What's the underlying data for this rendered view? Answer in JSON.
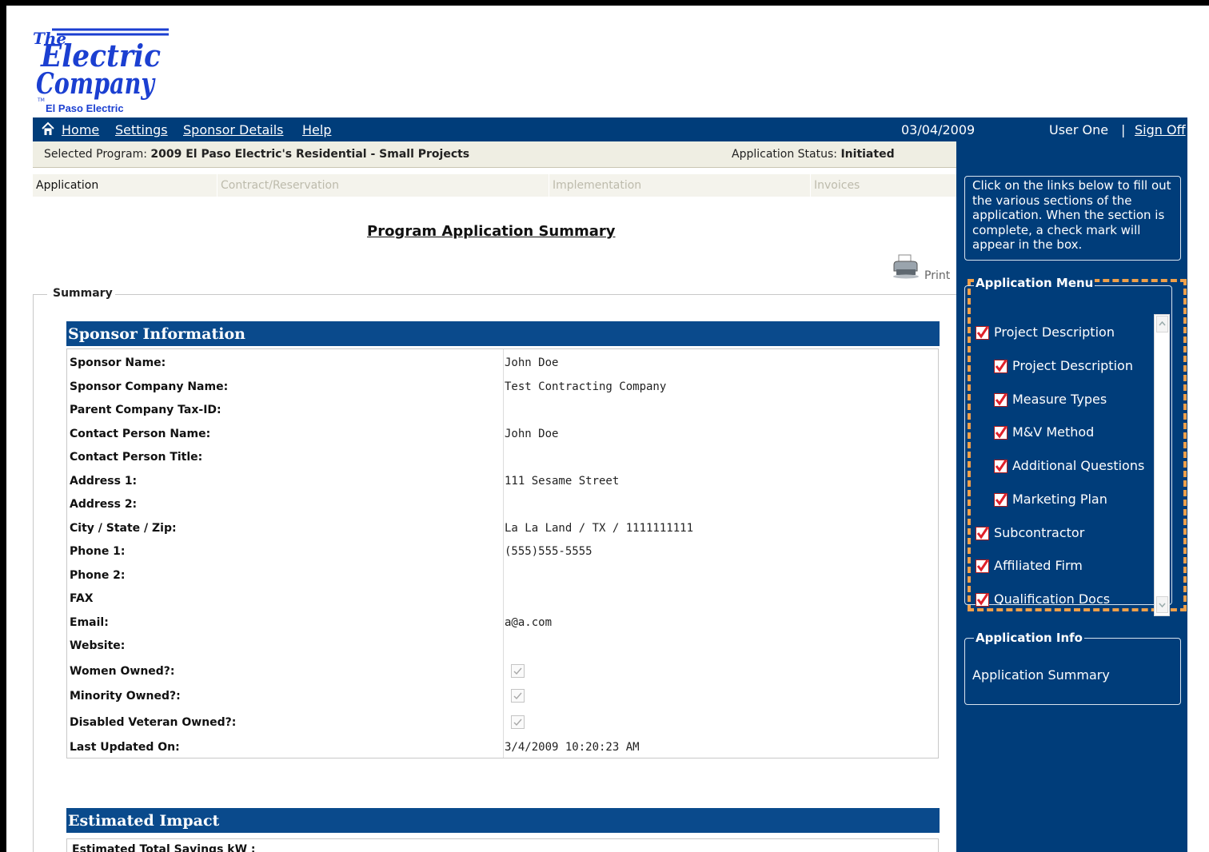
{
  "brand": {
    "logo_top": "The",
    "logo_word1": "Electric",
    "logo_word2": "Company",
    "logo_tm": "TM",
    "subtitle": "El Paso Electric"
  },
  "nav": {
    "home": "Home",
    "settings": "Settings",
    "sponsor_details": "Sponsor Details",
    "help": "Help",
    "date": "03/04/2009"
  },
  "user": {
    "name": "User One",
    "separator": "|",
    "sign_off": "Sign Off"
  },
  "program": {
    "selected_label": "Selected Program:",
    "selected_value": "2009 El Paso Electric's Residential - Small Projects",
    "status_label": "Application Status:",
    "status_value": "Initiated"
  },
  "tabs": [
    "Application",
    "Contract/Reservation",
    "Implementation",
    "Invoices"
  ],
  "page_title": "Program Application Summary",
  "print_label": "Print",
  "summary_legend": "Summary",
  "sponsor_section": {
    "title": "Sponsor Information",
    "rows": [
      {
        "label": "Sponsor Name:",
        "value": "John Doe"
      },
      {
        "label": "Sponsor Company Name:",
        "value": "Test Contracting Company"
      },
      {
        "label": "Parent Company Tax-ID:",
        "value": ""
      },
      {
        "label": "Contact Person Name:",
        "value": "John Doe"
      },
      {
        "label": "Contact Person Title:",
        "value": ""
      },
      {
        "label": "Address 1:",
        "value": "111 Sesame Street"
      },
      {
        "label": "Address 2:",
        "value": ""
      },
      {
        "label": "City / State / Zip:",
        "value": "La La Land / TX / 1111111111"
      },
      {
        "label": "Phone 1:",
        "value": "(555)555-5555"
      },
      {
        "label": "Phone 2:",
        "value": ""
      },
      {
        "label": "FAX",
        "value": ""
      },
      {
        "label": "Email:",
        "value": "a@a.com"
      },
      {
        "label": "Website:",
        "value": ""
      },
      {
        "label": "Women Owned?:",
        "checked": true
      },
      {
        "label": "Minority Owned?:",
        "checked": true
      },
      {
        "label": "Disabled Veteran Owned?:",
        "checked": true
      },
      {
        "label": "Last Updated On:",
        "value": "3/4/2009 10:20:23 AM"
      }
    ]
  },
  "impact_section": {
    "title": "Estimated Impact",
    "first_label": "Estimated Total Savings kW :"
  },
  "sidebar": {
    "help_text": "Click on the links below to fill out the various sections of the application. When the section is complete, a check mark will appear in the box.",
    "menu_title": "Application Menu",
    "menu_items": [
      {
        "label": "Project Description",
        "level": 0
      },
      {
        "label": "Project Description",
        "level": 1
      },
      {
        "label": "Measure Types",
        "level": 1
      },
      {
        "label": "M&V Method",
        "level": 1
      },
      {
        "label": "Additional Questions",
        "level": 1
      },
      {
        "label": "Marketing Plan",
        "level": 1
      },
      {
        "label": "Subcontractor",
        "level": 0
      },
      {
        "label": "Affiliated Firm",
        "level": 0
      },
      {
        "label": "Qualification Docs",
        "level": 0
      }
    ],
    "info_title": "Application Info",
    "info_link": "Application Summary"
  },
  "colors": {
    "nav_blue": "#003d7a",
    "section_blue": "#0a4a8c",
    "highlight_orange": "#f0a04a",
    "check_red": "#e0202a"
  }
}
